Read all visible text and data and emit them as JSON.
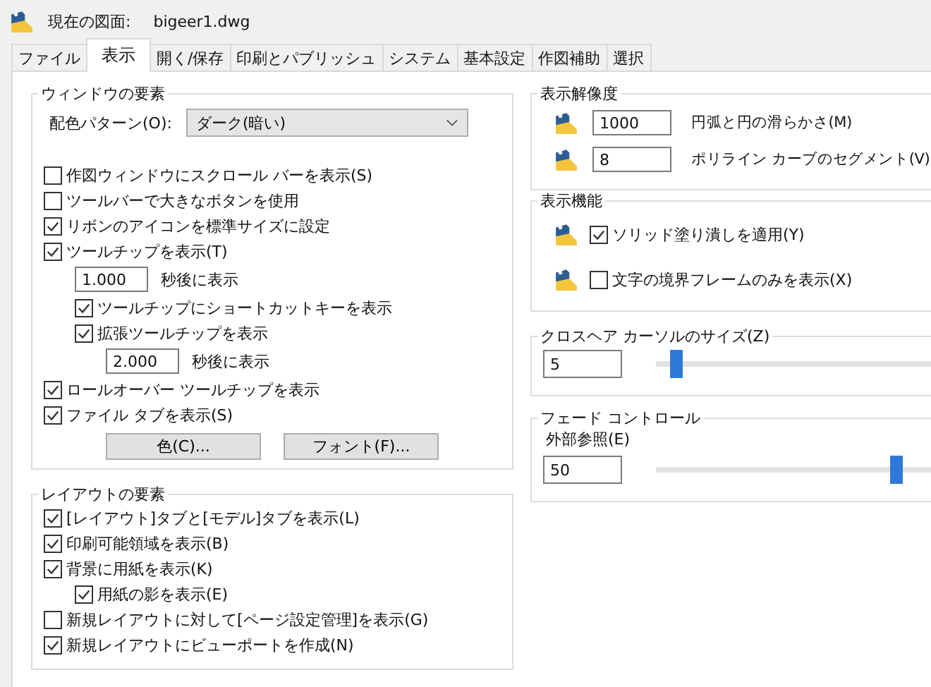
{
  "header": {
    "label": "現在の図面:",
    "drawing": "bigeer1.dwg"
  },
  "tabs": [
    {
      "label": "ファイル",
      "selected": false
    },
    {
      "label": "表示",
      "selected": true
    },
    {
      "label": "開く/保存",
      "selected": false
    },
    {
      "label": "印刷とパブリッシュ",
      "selected": false
    },
    {
      "label": "システム",
      "selected": false
    },
    {
      "label": "基本設定",
      "selected": false
    },
    {
      "label": "作図補助",
      "selected": false
    },
    {
      "label": "選択",
      "selected": false
    }
  ],
  "window_elements": {
    "title": "ウィンドウの要素",
    "color_scheme": {
      "label": "配色パターン(O):",
      "value": "ダーク(暗い)"
    },
    "options": [
      {
        "kind": "checkbox",
        "label": "作図ウィンドウにスクロール バーを表示(S)",
        "checked": false
      },
      {
        "kind": "checkbox",
        "label": "ツールバーで大きなボタンを使用",
        "checked": false
      },
      {
        "kind": "checkbox",
        "label": "リボンのアイコンを標準サイズに設定",
        "checked": true
      },
      {
        "kind": "checkbox",
        "label": "ツールチップを表示(T)",
        "checked": true,
        "children": [
          {
            "kind": "field",
            "value": "1.000",
            "label": "秒後に表示"
          },
          {
            "kind": "checkbox",
            "label": "ツールチップにショートカットキーを表示",
            "checked": true
          },
          {
            "kind": "checkbox",
            "label": "拡張ツールチップを表示",
            "checked": true,
            "children": [
              {
                "kind": "field",
                "value": "2.000",
                "label": "秒後に表示"
              }
            ]
          }
        ]
      },
      {
        "kind": "checkbox",
        "label": "ロールオーバー ツールチップを表示",
        "checked": true
      },
      {
        "kind": "checkbox",
        "label": "ファイル タブを表示(S)",
        "checked": true
      }
    ],
    "buttons": [
      "色(C)...",
      "フォント(F)..."
    ]
  },
  "layout_elements": {
    "title": "レイアウトの要素",
    "options": [
      {
        "kind": "checkbox",
        "label": "[レイアウト]タブと[モデル]タブを表示(L)",
        "checked": true
      },
      {
        "kind": "checkbox",
        "label": "印刷可能領域を表示(B)",
        "checked": true
      },
      {
        "kind": "checkbox",
        "label": "背景に用紙を表示(K)",
        "checked": true,
        "children": [
          {
            "kind": "checkbox",
            "label": "用紙の影を表示(E)",
            "checked": true
          }
        ]
      },
      {
        "kind": "checkbox",
        "label": "新規レイアウトに対して[ページ設定管理]を表示(G)",
        "checked": false
      },
      {
        "kind": "checkbox",
        "label": "新規レイアウトにビューポートを作成(N)",
        "checked": true
      }
    ]
  },
  "display_resolution": {
    "title": "表示解像度",
    "rows": [
      {
        "value": "1000",
        "label": "円弧と円の滑らかさ(M)"
      },
      {
        "value": "8",
        "label": "ポリライン カーブのセグメント(V)"
      }
    ]
  },
  "display_performance": {
    "title": "表示機能",
    "options": [
      {
        "label": "ソリッド塗り潰しを適用(Y)",
        "checked": true
      },
      {
        "label": "文字の境界フレームのみを表示(X)",
        "checked": false
      }
    ]
  },
  "crosshair": {
    "title": "クロスヘア カーソルのサイズ(Z)",
    "value": "5",
    "level": 0.04
  },
  "fade": {
    "title": "フェード コントロール",
    "label": "外部参照(E)",
    "value": "50",
    "level": 0.5
  }
}
